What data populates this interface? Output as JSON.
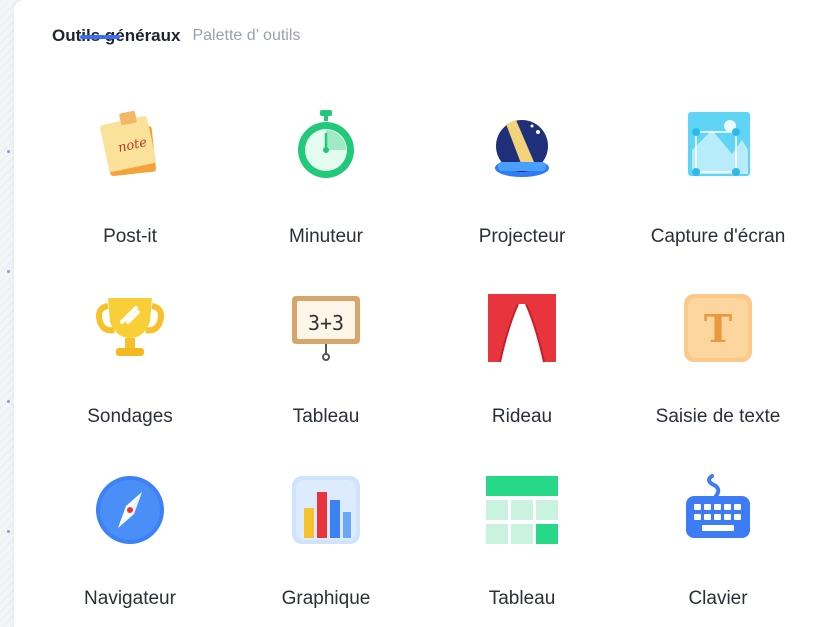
{
  "tabs": [
    {
      "label": "Outils généraux",
      "active": true
    },
    {
      "label": "Palette d’ outils",
      "active": false
    }
  ],
  "tools": [
    {
      "label": "Post-it",
      "icon": "post-it-icon"
    },
    {
      "label": "Minuteur",
      "icon": "stopwatch-icon"
    },
    {
      "label": "Projecteur",
      "icon": "spotlight-icon"
    },
    {
      "label": "Capture d'écran",
      "icon": "screenshot-icon"
    },
    {
      "label": "Sondages",
      "icon": "trophy-icon"
    },
    {
      "label": "Tableau",
      "icon": "blackboard-icon"
    },
    {
      "label": "Rideau",
      "icon": "curtain-icon"
    },
    {
      "label": "Saisie de texte",
      "icon": "text-input-icon"
    },
    {
      "label": "Navigateur",
      "icon": "compass-icon"
    },
    {
      "label": "Graphique",
      "icon": "bar-chart-icon"
    },
    {
      "label": "Tableau",
      "icon": "table-icon"
    },
    {
      "label": "Clavier",
      "icon": "keyboard-icon"
    }
  ],
  "icon_text": {
    "note": "note",
    "board": "3+3",
    "text_t": "T"
  },
  "colors": {
    "accent": "#3b6ef5",
    "timer_green": "#22c97a",
    "curtain_red": "#e8343c",
    "table_green": "#27d889",
    "keyboard_blue": "#3d7cf5"
  }
}
